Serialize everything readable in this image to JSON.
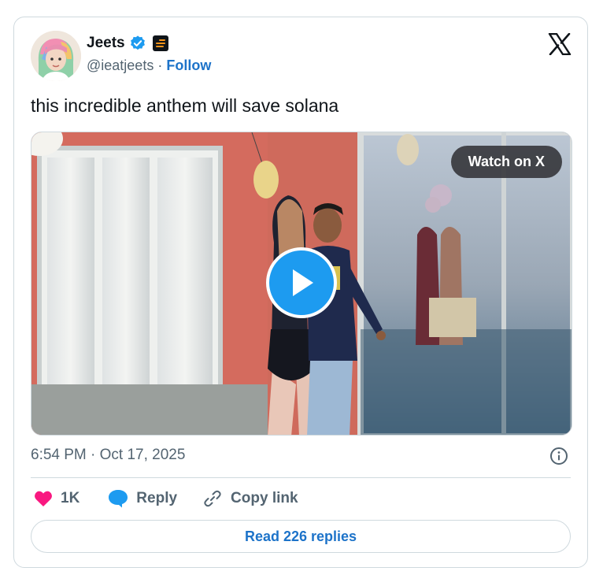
{
  "tweet": {
    "author": {
      "name": "Jeets",
      "handle": "@ieatjeets",
      "separator": "·",
      "follow_label": "Follow",
      "verified": true,
      "icons": [
        "avatar",
        "verified-badge-icon",
        "affiliate-badge-icon"
      ]
    },
    "text": "this incredible anthem will save solana",
    "media": {
      "watch_label": "Watch on X",
      "icons": [
        "play-icon"
      ]
    },
    "timestamp": "6:54 PM · Oct 17, 2025",
    "actions": {
      "like_count": "1K",
      "reply_label": "Reply",
      "copy_link_label": "Copy link"
    },
    "read_replies_label": "Read 226 replies"
  },
  "colors": {
    "accent": "#1d9bf0",
    "link": "#1d73c9",
    "like": "#f91880",
    "secondary_text": "#536471",
    "border": "#cfd9de"
  },
  "icons": [
    "x-logo-icon",
    "info-icon",
    "heart-icon",
    "reply-bubble-icon",
    "link-icon"
  ]
}
